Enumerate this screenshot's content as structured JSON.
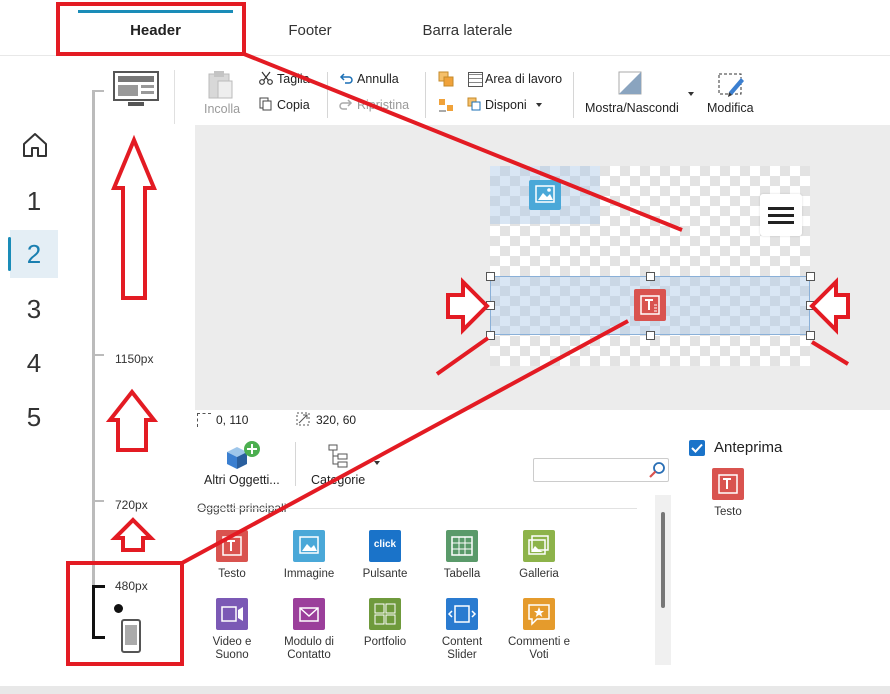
{
  "tabs": [
    {
      "label": "Header"
    },
    {
      "label": "Footer"
    },
    {
      "label": "Barra laterale"
    }
  ],
  "nav": [
    "1",
    "2",
    "3",
    "4",
    "5"
  ],
  "breakpoints": {
    "bp1": "1150px",
    "bp2": "720px",
    "bp3": "480px"
  },
  "toolbar": {
    "paste": "Incolla",
    "cut": "Taglia",
    "copy": "Copia",
    "undo": "Annulla",
    "redo": "Ripristina",
    "workarea": "Area di lavoro",
    "arrange": "Disponi",
    "showhide": "Mostra/Nascondi",
    "edit": "Modifica"
  },
  "status": {
    "position": "0, 110",
    "size": "320, 60"
  },
  "objects_toolbar": {
    "more": "Altri Oggetti...",
    "categories": "Categorie"
  },
  "search": {
    "placeholder": ""
  },
  "section_title": "Oggetti principali",
  "objects": [
    {
      "name": "obj-testo",
      "label": "Testo",
      "color": "#d9534f"
    },
    {
      "name": "obj-immagine",
      "label": "Immagine",
      "color": "#4aa8d8"
    },
    {
      "name": "obj-pulsante",
      "label": "Pulsante",
      "color": "#1a73c9"
    },
    {
      "name": "obj-tabella",
      "label": "Tabella",
      "color": "#5a9a6a"
    },
    {
      "name": "obj-galleria",
      "label": "Galleria",
      "color": "#8db34a"
    },
    {
      "name": "obj-video",
      "label": "Video e Suono",
      "color": "#7b59b5"
    },
    {
      "name": "obj-modulo",
      "label": "Modulo di Contatto",
      "color": "#9b3f9b"
    },
    {
      "name": "obj-portfolio",
      "label": "Portfolio",
      "color": "#6f9a3c"
    },
    {
      "name": "obj-slider",
      "label": "Content Slider",
      "color": "#2a7bd0"
    },
    {
      "name": "obj-commenti",
      "label": "Commenti e Voti",
      "color": "#e59b2c"
    }
  ],
  "button_icon_text": "click",
  "preview": {
    "label": "Anteprima",
    "checked": true,
    "object": "Testo"
  },
  "colors": {
    "accent": "#1a8cb8",
    "annotation": "#e31b23"
  }
}
